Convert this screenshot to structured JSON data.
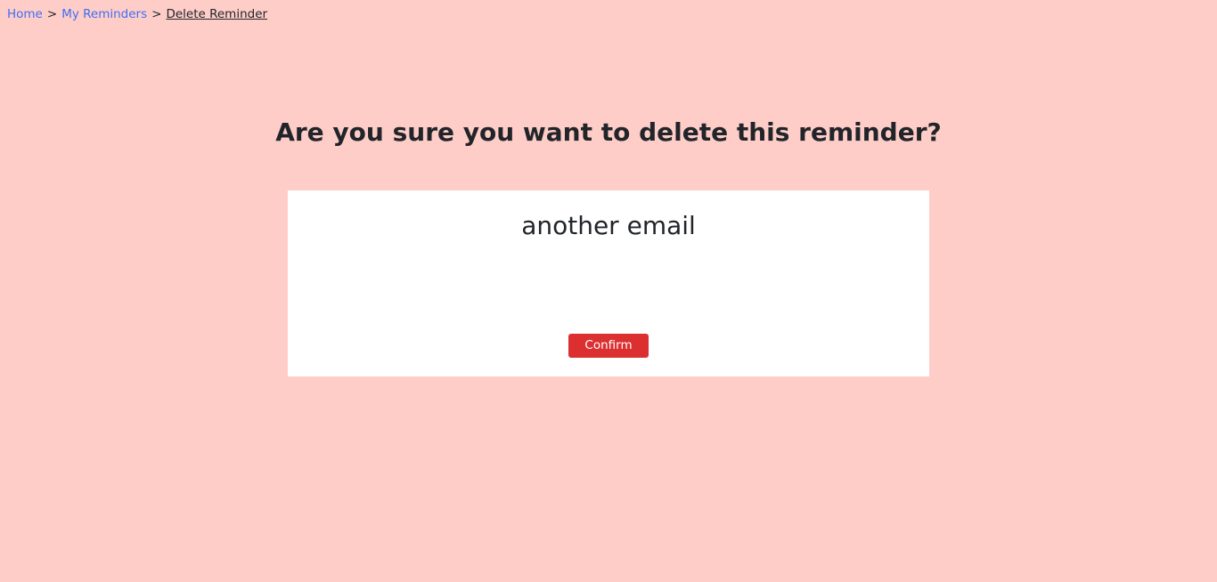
{
  "breadcrumb": {
    "items": [
      {
        "label": "Home"
      },
      {
        "label": "My Reminders"
      },
      {
        "label": "Delete Reminder"
      }
    ],
    "separator": ">"
  },
  "page": {
    "title": "Are you sure you want to delete this reminder?"
  },
  "reminder": {
    "title": "another email"
  },
  "actions": {
    "confirm_label": "Confirm"
  },
  "colors": {
    "background": "#ffcdc8",
    "link": "#3d6ef5",
    "danger": "#dc2f2f",
    "text": "#212529",
    "card": "#ffffff"
  }
}
